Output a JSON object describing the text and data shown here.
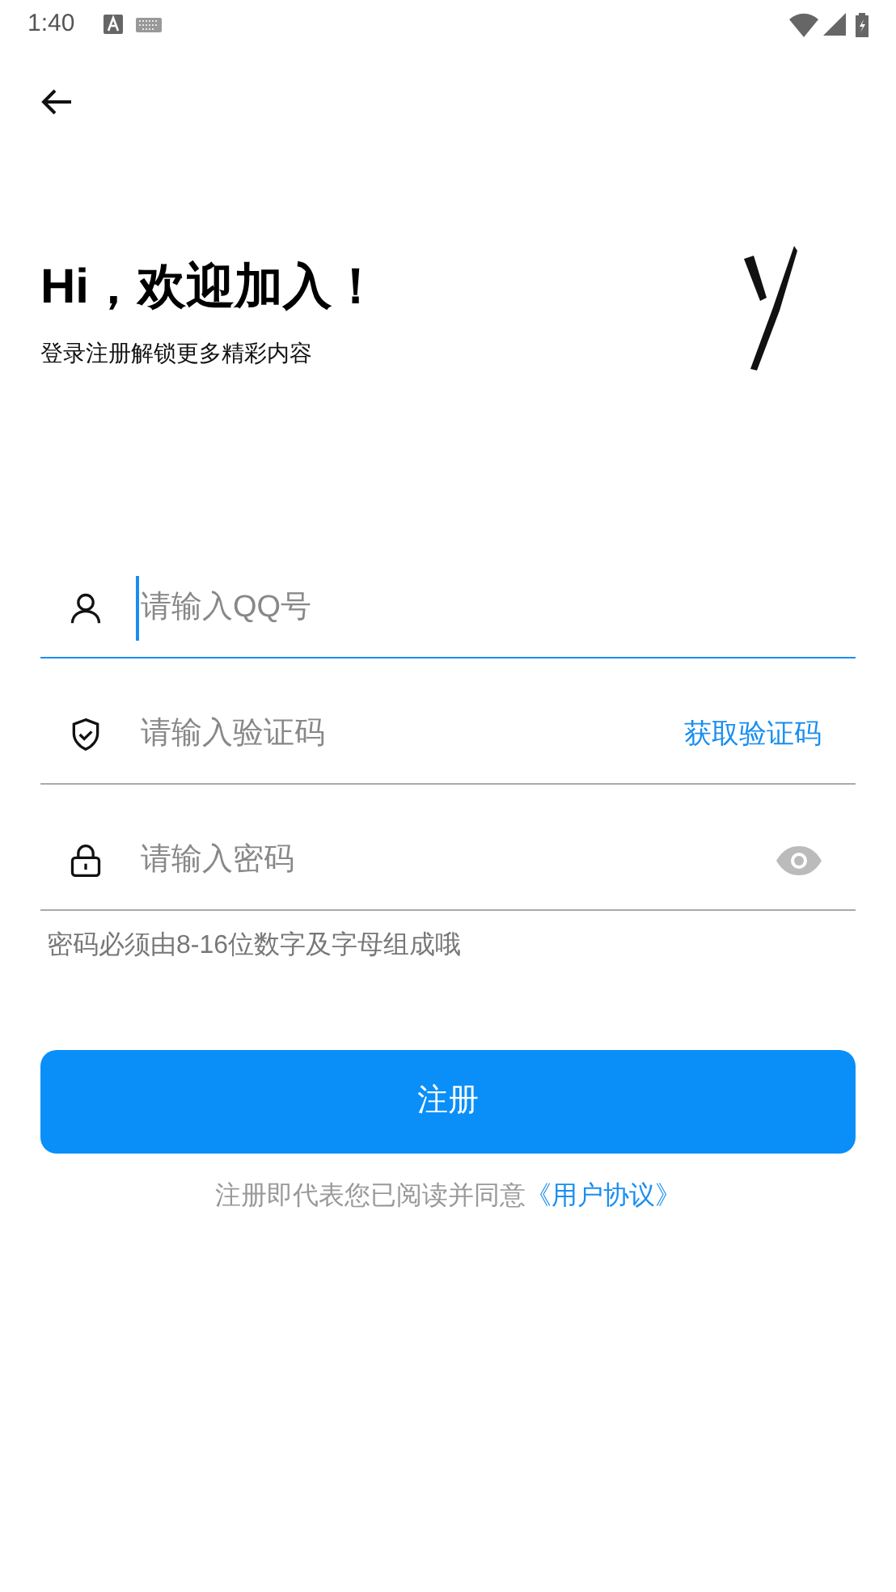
{
  "status_bar": {
    "time": "1:40"
  },
  "header": {
    "title": "Hi，欢迎加入！",
    "subtitle": "登录注册解锁更多精彩内容"
  },
  "fields": [
    {
      "kind": "account",
      "placeholder": "请输入QQ号",
      "focused": true
    },
    {
      "kind": "code",
      "placeholder": "请输入验证码",
      "focused": false,
      "action": "获取验证码"
    },
    {
      "kind": "password",
      "placeholder": "请输入密码",
      "focused": false
    }
  ],
  "password_hint": "密码必须由8-16位数字及字母组成哦",
  "register_button": "注册",
  "agreement": {
    "text": "注册即代表您已阅读并同意",
    "link": "《用户协议》"
  }
}
